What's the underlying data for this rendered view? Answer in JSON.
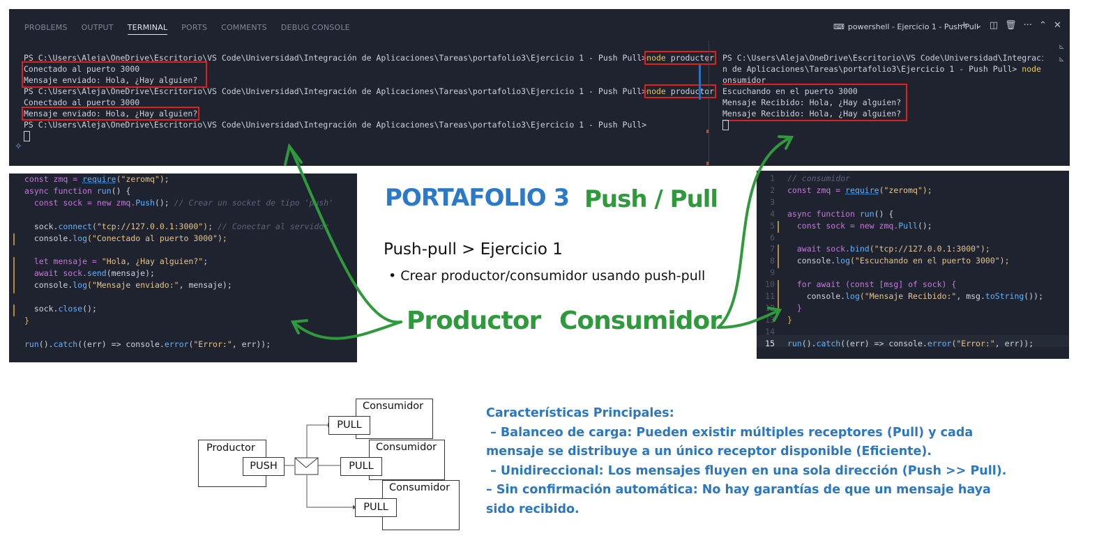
{
  "terminal": {
    "tabs": [
      "PROBLEMS",
      "OUTPUT",
      "TERMINAL",
      "PORTS",
      "COMMENTS",
      "DEBUG CONSOLE"
    ],
    "active_tab": "TERMINAL",
    "title": "powershell - Ejercicio 1 - Push Pull",
    "left_pane": {
      "prompt": "PS C:\\Users\\Aleja\\OneDrive\\Escritorio\\VS Code\\Universidad\\Integración de Aplicaciones\\Tareas\\portafolio3\\Ejercicio 1 - Push Pull>",
      "cmd_node": "node",
      "cmd_arg": " productor",
      "out_connected": "Conectado al puerto 3000",
      "out_sent": "Mensaje enviado: Hola, ¿Hay alguien?"
    },
    "right_pane": {
      "line1": "PS C:\\Users\\Aleja\\OneDrive\\Escritorio\\VS Code\\Universidad\\Integració",
      "line2a": "n de Aplicaciones\\Tareas\\portafolio3\\Ejercicio 1 - Push Pull> ",
      "line2b": "node",
      "line2c": " c",
      "line3": "onsumidor",
      "listening": "Escuchando en el puerto 3000",
      "received": "Mensaje Recibido: Hola, ¿Hay alguien?"
    }
  },
  "code_left": {
    "l1a": "const zmq = ",
    "l1b": "require",
    "l1c": "(\"zeromq\");",
    "l2a": "async function ",
    "l2b": "run",
    "l2c": "() {",
    "l3a": "  const sock = new zmq.",
    "l3b": "Push",
    "l3c": "(); ",
    "l3d": "// Crear un socket de tipo 'push'",
    "l5a": "  sock.",
    "l5b": "connect",
    "l5c": "(\"tcp://127.0.0.1:3000\"); ",
    "l5d": "// Conectar al servidor",
    "l6a": "  console.",
    "l6b": "log",
    "l6c": "(\"Conectado al puerto 3000\");",
    "l8a": "  let mensaje = ",
    "l8b": "\"Hola, ¿Hay alguien?\"",
    "l8c": ";",
    "l9a": "  await sock.",
    "l9b": "send",
    "l9c": "(mensaje);",
    "l10a": "  console.",
    "l10b": "log",
    "l10c": "(\"Mensaje enviado:\"",
    "l10d": ", mensaje);",
    "l12a": "  sock.",
    "l12b": "close",
    "l12c": "();",
    "l13": "}",
    "l15a": "run",
    "l15b": "().",
    "l15c": "catch",
    "l15d": "((err) => console.",
    "l15e": "error",
    "l15f": "(\"Error:\"",
    "l15g": ", err));"
  },
  "code_right": {
    "numbers": [
      "1",
      "2",
      "3",
      "4",
      "5",
      "6",
      "7",
      "8",
      "9",
      "10",
      "11",
      "12",
      "13",
      "14",
      "15"
    ],
    "r1": "// consumidor",
    "r2a": "const zmq = ",
    "r2b": "require",
    "r2c": "(\"zeromq\");",
    "r4a": "async function ",
    "r4b": "run",
    "r4c": "() {",
    "r5a": "  const sock = new zmq.",
    "r5b": "Pull",
    "r5c": "();",
    "r7a": "  await sock.",
    "r7b": "bind",
    "r7c": "(\"tcp://127.0.0.1:3000\");",
    "r8a": "  console.",
    "r8b": "log",
    "r8c": "(\"Escuchando en el puerto 3000\");",
    "r10a": "  for await (const [msg] of sock) {",
    "r11a": "    console.",
    "r11b": "log",
    "r11c": "(\"Mensaje Recibido:\"",
    "r11d": ", msg.",
    "r11e": "toString",
    "r11f": "());",
    "r12": "  }",
    "r13": "}",
    "r15a": "run",
    "r15b": "().",
    "r15c": "catch",
    "r15d": "((err) => console.",
    "r15e": "error",
    "r15f": "(\"Error:\"",
    "r15g": ", err));"
  },
  "center": {
    "title_main": "PORTAFOLIO 3",
    "title_topic": "Push / Pull",
    "subtitle": "Push-pull > Ejercicio 1",
    "bullet": "Crear productor/consumidor usando push-pull",
    "producer_label": "Productor",
    "consumer_label": "Consumidor"
  },
  "diagram": {
    "producer": "Productor",
    "push": "PUSH",
    "pull": "PULL",
    "consumer": "Consumidor"
  },
  "characteristics": {
    "heading": "Características Principales:",
    "lines": [
      " – Balanceo de carga: Pueden existir múltiples receptores (Pull) y cada",
      "mensaje se distribuye a un único receptor disponible (Eficiente).",
      " – Unidireccional: Los mensajes fluyen en una sola dirección (Push >> Pull).",
      "– Sin confirmación automática: No hay garantías de que un mensaje haya",
      "sido recibido."
    ]
  }
}
